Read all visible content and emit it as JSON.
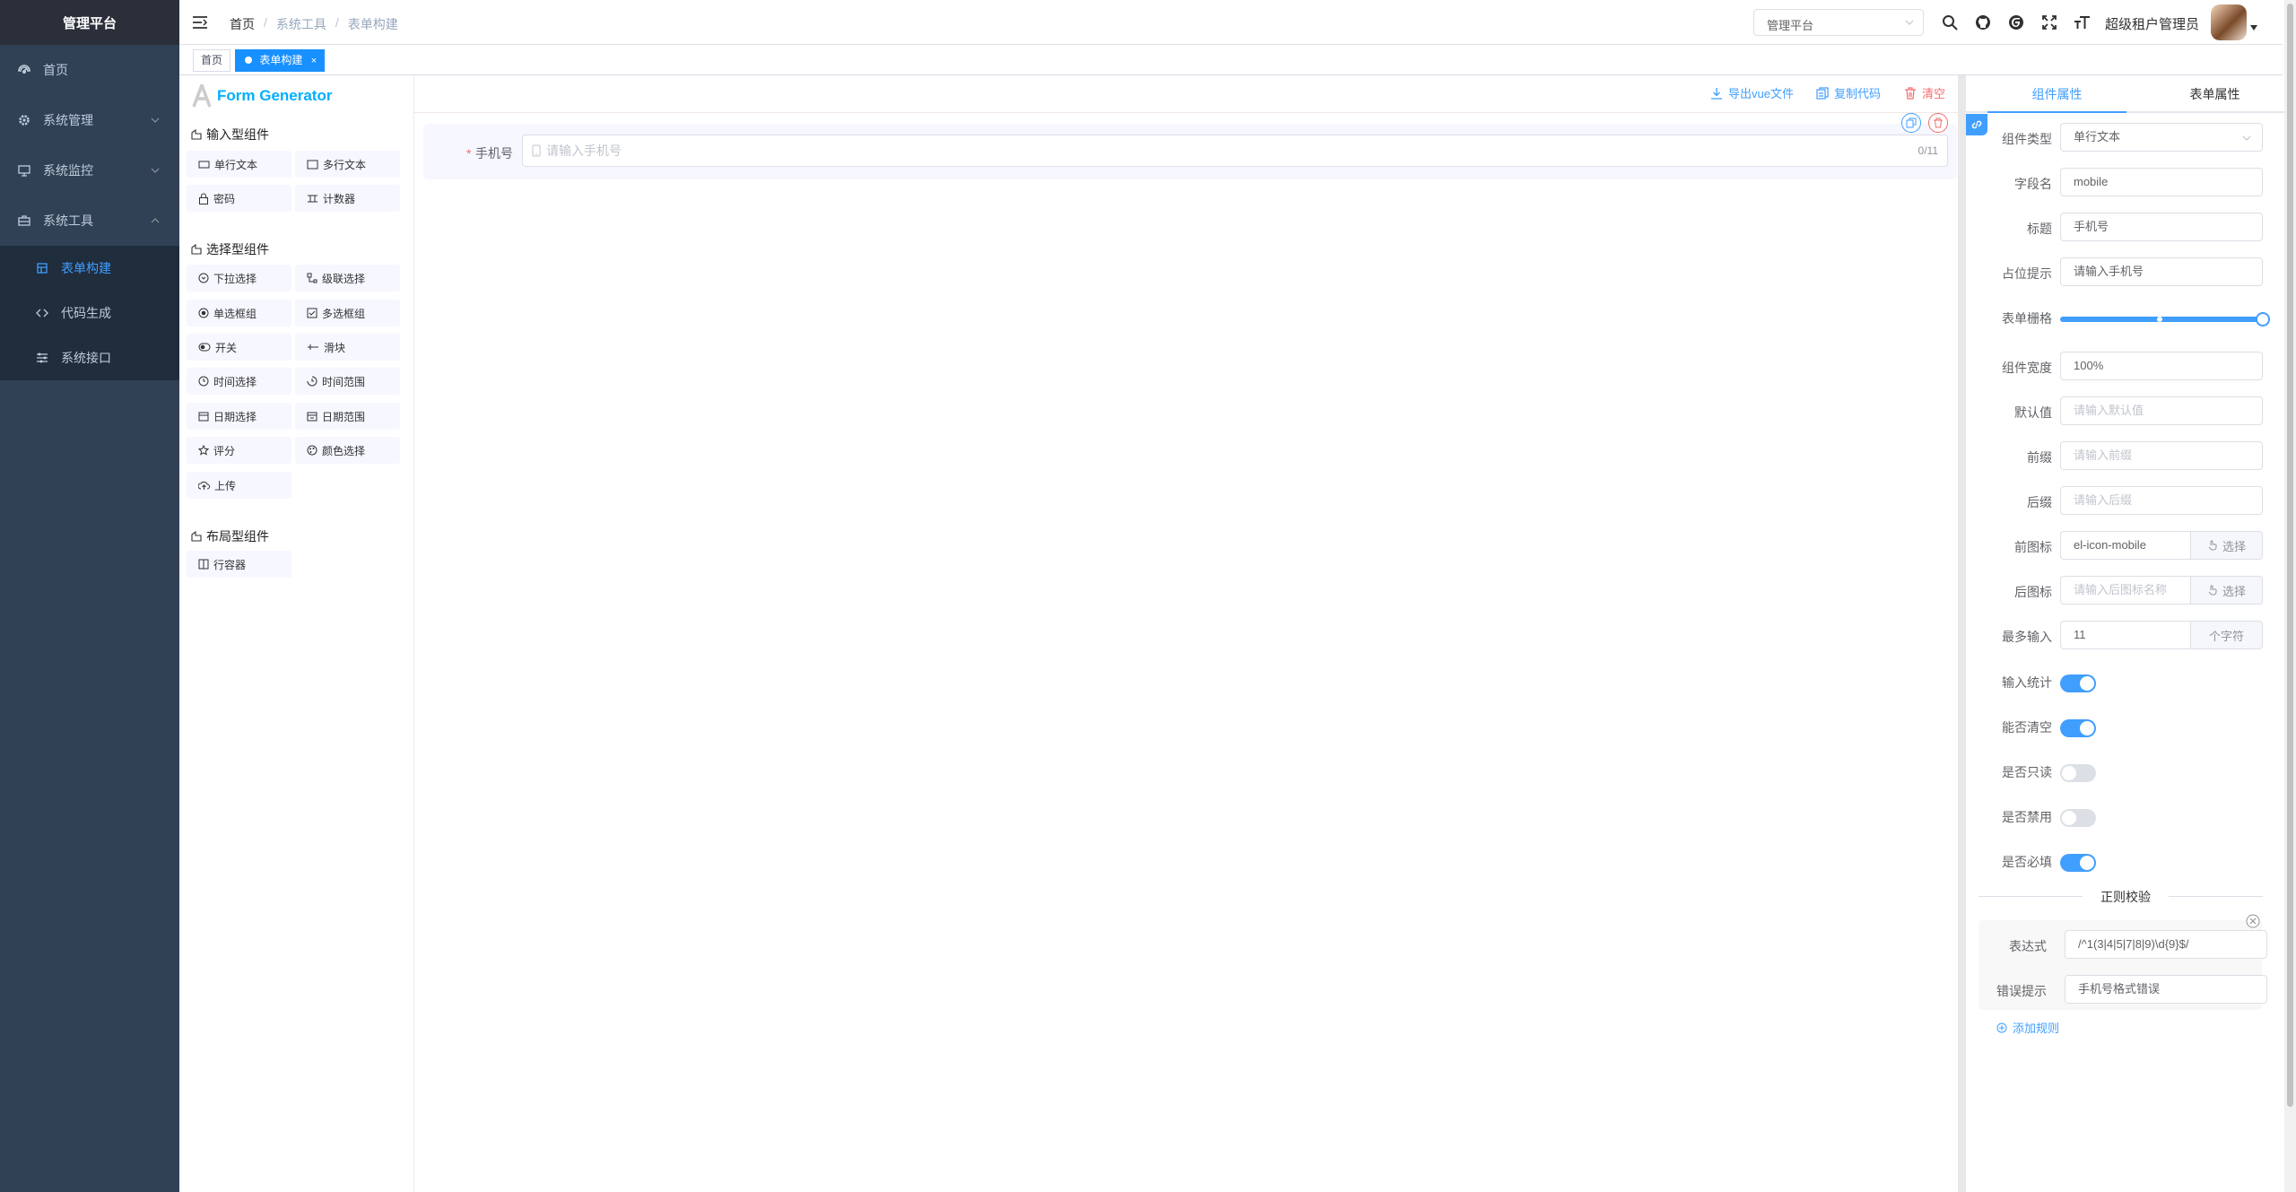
{
  "sidebar": {
    "logo_title": "管理平台",
    "items": [
      {
        "label": "首页",
        "icon": "dashboard-icon"
      },
      {
        "label": "系统管理",
        "icon": "gear-icon"
      },
      {
        "label": "系统监控",
        "icon": "monitor-icon"
      },
      {
        "label": "系统工具",
        "icon": "toolbox-icon"
      }
    ],
    "sub_items": [
      {
        "label": "表单构建",
        "icon": "form-icon",
        "active": true
      },
      {
        "label": "代码生成",
        "icon": "code-icon"
      },
      {
        "label": "系统接口",
        "icon": "api-icon"
      }
    ]
  },
  "navbar": {
    "breadcrumb": [
      "首页",
      "系统工具",
      "表单构建"
    ],
    "separator": "/",
    "platform_select": "管理平台",
    "icons": [
      "search-icon",
      "github-icon",
      "gitee-icon",
      "fullscreen-icon",
      "font-size-icon"
    ],
    "user_name": "超级租户管理员"
  },
  "tags": {
    "home": "首页",
    "active": "表单构建",
    "close": "×"
  },
  "left_panel": {
    "logo_text": "Form Generator",
    "groups": [
      {
        "title": "输入型组件",
        "items": [
          "单行文本",
          "多行文本",
          "密码",
          "计数器"
        ]
      },
      {
        "title": "选择型组件",
        "items": [
          "下拉选择",
          "级联选择",
          "单选框组",
          "多选框组",
          "开关",
          "滑块",
          "时间选择",
          "时间范围",
          "日期选择",
          "日期范围",
          "评分",
          "颜色选择",
          "上传"
        ]
      },
      {
        "title": "布局型组件",
        "items": [
          "行容器"
        ]
      }
    ]
  },
  "toolbar": {
    "export": "导出vue文件",
    "copy": "复制代码",
    "clear": "清空"
  },
  "canvas": {
    "required_mark": "*",
    "field_label": "手机号",
    "placeholder": "请输入手机号",
    "counter": "0/11"
  },
  "right_panel": {
    "tabs": [
      "组件属性",
      "表单属性"
    ],
    "props": {
      "type_label": "组件类型",
      "type_value": "单行文本",
      "field_label": "字段名",
      "field_value": "mobile",
      "title_label": "标题",
      "title_value": "手机号",
      "placeholder_label": "占位提示",
      "placeholder_value": "请输入手机号",
      "grid_label": "表单栅格",
      "grid_fraction": 1.0,
      "width_label": "组件宽度",
      "width_value": "100%",
      "default_label": "默认值",
      "default_placeholder": "请输入默认值",
      "prefix_label": "前缀",
      "prefix_placeholder": "请输入前缀",
      "suffix_label": "后缀",
      "suffix_placeholder": "请输入后缀",
      "prefix_icon_label": "前图标",
      "prefix_icon_value": "el-icon-mobile",
      "select_btn": "选择",
      "suffix_icon_label": "后图标",
      "suffix_icon_placeholder": "请输入后图标名称",
      "maxlen_label": "最多输入",
      "maxlen_value": "11",
      "maxlen_append": "个字符",
      "show_count_label": "输入统计",
      "show_count": true,
      "clearable_label": "能否清空",
      "clearable": true,
      "readonly_label": "是否只读",
      "readonly": false,
      "disabled_label": "是否禁用",
      "disabled": false,
      "required_label": "是否必填",
      "required": true
    },
    "regex": {
      "divider": "正则校验",
      "expr_label": "表达式",
      "expr_value": "/^1(3|4|5|7|8|9)\\d{9}$/",
      "msg_label": "错误提示",
      "msg_value": "手机号格式错误",
      "add_rule": "添加规则"
    }
  },
  "colors": {
    "sidebar_bg": "#304156",
    "logo_bg": "#2b2f3a",
    "accent": "#409eff",
    "danger": "#f56c6c",
    "tag_active": "#1890ff"
  }
}
